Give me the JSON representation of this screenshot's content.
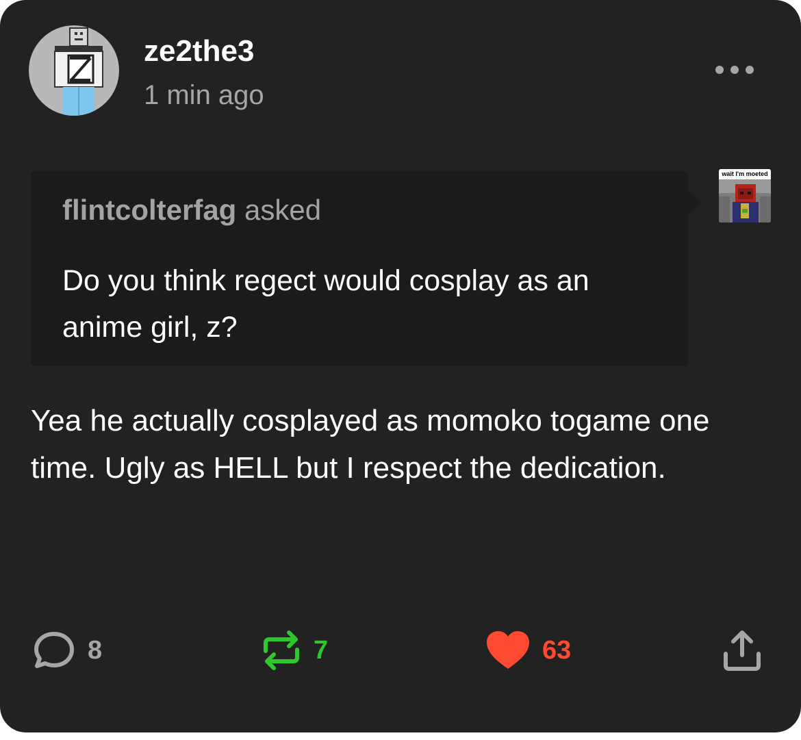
{
  "post": {
    "username": "ze2the3",
    "timestamp": "1 min ago",
    "more_icon": "ellipsis-icon"
  },
  "ask": {
    "asker": "flintcolterfag",
    "asked_label": "asked",
    "question": "Do you think regect would cosplay as an anime girl, z?",
    "thumbnail_caption": "wait I'm moeted"
  },
  "answer": {
    "text": "Yea he actually cosplayed as momoko togame one time. Ugly as HELL but I respect the dedication."
  },
  "actions": {
    "replies": "8",
    "reblogs": "7",
    "likes": "63"
  },
  "colors": {
    "card_background": "#222222",
    "ask_background": "#1b1b1b",
    "reblog_green": "#2ec72e",
    "like_red": "#ff4930",
    "muted_text": "#a6a6a6"
  }
}
